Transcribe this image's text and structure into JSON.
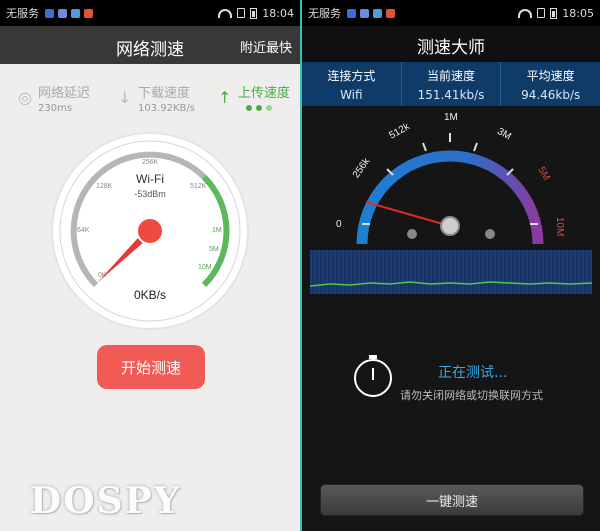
{
  "left": {
    "status": {
      "carrier": "无服务",
      "time": "18:04"
    },
    "header": {
      "title": "网络测速",
      "nearby": "附近最快"
    },
    "stats": [
      {
        "label": "网络延迟",
        "value": "230ms",
        "icon": "latency-icon"
      },
      {
        "label": "下载速度",
        "value": "103.92KB/s",
        "icon": "download-arrow-icon"
      },
      {
        "label": "上传速度",
        "value": "",
        "icon": "upload-arrow-icon"
      }
    ],
    "gauge": {
      "ticks": [
        "0K",
        "64K",
        "128K",
        "256K",
        "512K",
        "1M",
        "5M",
        "10M"
      ],
      "network": "Wi-Fi",
      "signal": "-53dBm",
      "speed": "0KB/s"
    },
    "start_button": "开始测速",
    "watermark": "DOSPY",
    "colors": {
      "accent": "#f15a55",
      "green": "#4caa4a",
      "header": "#3a3836"
    }
  },
  "right": {
    "status": {
      "carrier": "无服务",
      "time": "18:05"
    },
    "header": {
      "title": "测速大师"
    },
    "stats": [
      {
        "label": "连接方式",
        "value": "Wifi"
      },
      {
        "label": "当前速度",
        "value": "151.41kb/s"
      },
      {
        "label": "平均速度",
        "value": "94.46kb/s"
      }
    ],
    "gauge": {
      "ticks": [
        "0",
        "256k",
        "512k",
        "1M",
        "3M",
        "5M",
        "10M"
      ]
    },
    "testing": {
      "title": "正在测试...",
      "hint": "请勿关闭网络或切换联网方式"
    },
    "button": "一键测速",
    "colors": {
      "accent": "#3aa8e6",
      "bar": "#0f3b69"
    }
  }
}
